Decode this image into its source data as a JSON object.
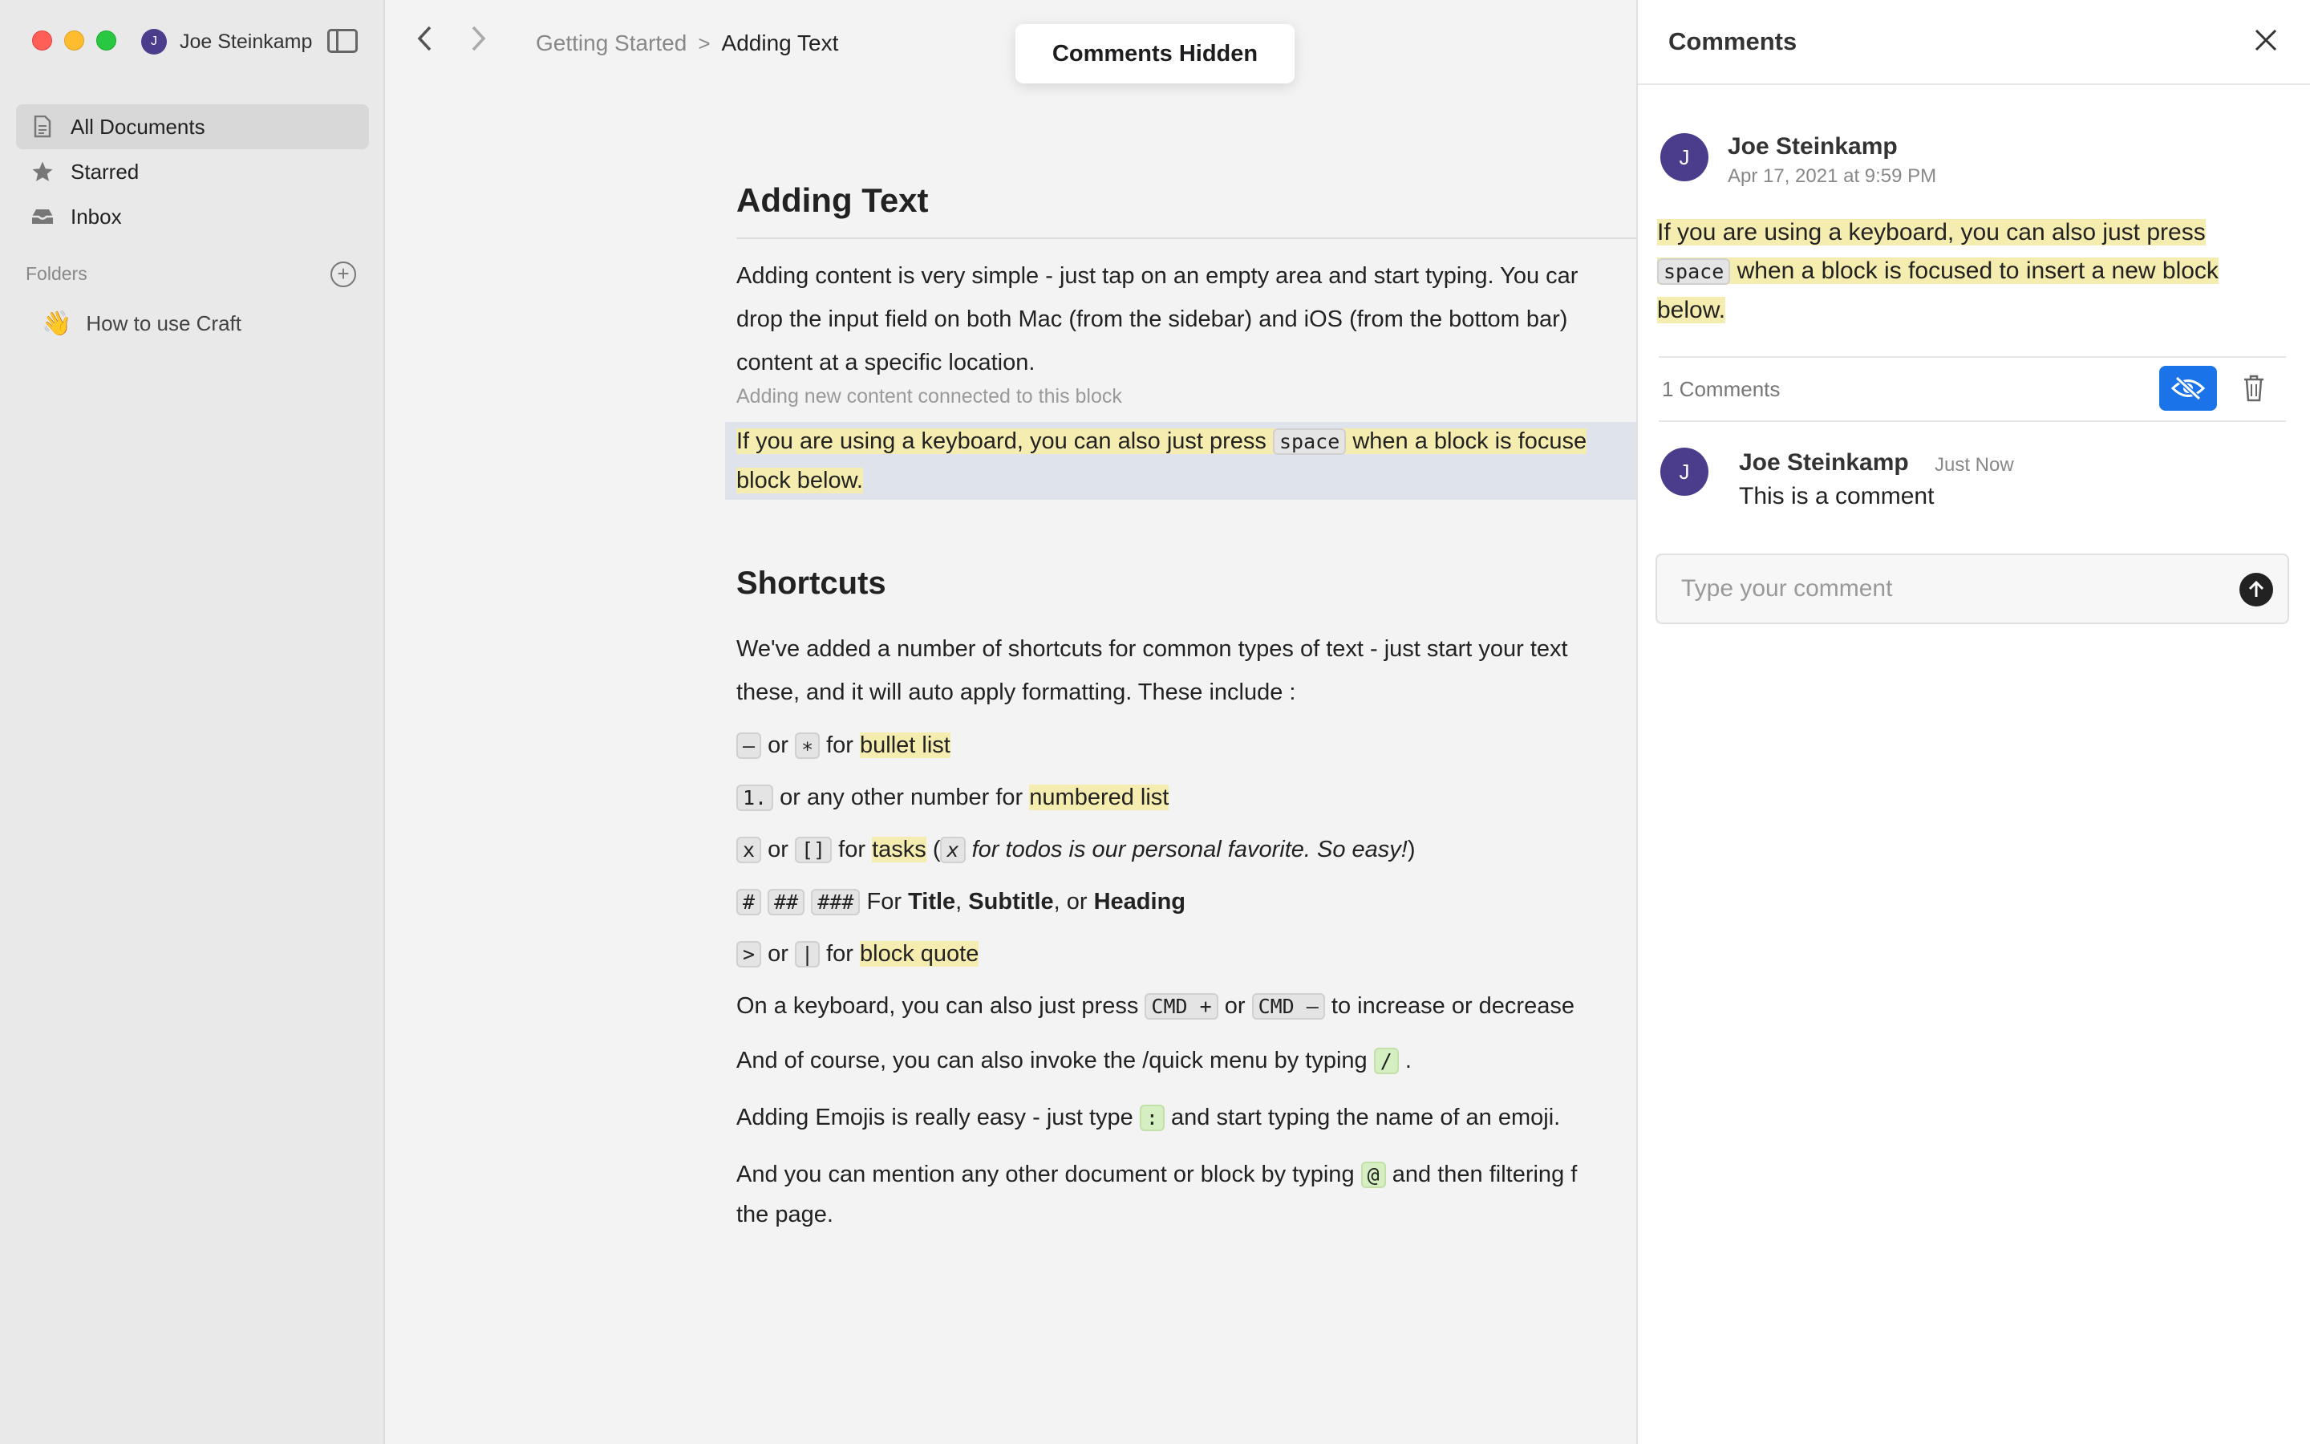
{
  "sidebar": {
    "user": {
      "initial": "J",
      "name": "Joe Steinkamp"
    },
    "nav": [
      {
        "label": "All Documents",
        "icon": "document-icon",
        "active": true
      },
      {
        "label": "Starred",
        "icon": "star-icon"
      },
      {
        "label": "Inbox",
        "icon": "inbox-icon"
      }
    ],
    "folders_label": "Folders",
    "folders": [
      {
        "emoji": "👋",
        "label": "How to use Craft"
      }
    ]
  },
  "toolbar": {
    "breadcrumb_parent": "Getting Started",
    "breadcrumb_separator": ">",
    "breadcrumb_current": "Adding Text",
    "toast": "Comments Hidden"
  },
  "document": {
    "title": "Adding Text",
    "intro_1": "Adding content is very simple - just tap on an empty area and start typing. You car",
    "intro_2": "drop the input field on both Mac (from the sidebar) and iOS (from the bottom bar)",
    "intro_3": "content at a specific location.",
    "meta_line": "Adding new content connected to this block",
    "selected_a": "If you are using a keyboard, you can also just press",
    "selected_code": "space",
    "selected_b": "when a block is focuse",
    "selected_c": "block below.",
    "shortcuts_title": "Shortcuts",
    "shortcuts_1": "We've added a number of shortcuts for common types of text - just start your text",
    "shortcuts_2": "these, and it will auto apply formatting. These include :",
    "l1": {
      "code_a": "–",
      "or": "or",
      "code_b": "∗",
      "for": "for",
      "hl": "bullet list"
    },
    "l2": {
      "code": "1.",
      "text": "or any other number for",
      "hl": "numbered list"
    },
    "l3": {
      "code_a": "x",
      "or": "or",
      "code_b": "[]",
      "for": "for",
      "hl": "tasks",
      "paren_open": "(",
      "code_c": "x",
      "italic": "for todos is our personal favorite. So easy!",
      "paren_close": ")"
    },
    "l4": {
      "code_a": "#",
      "code_b": "##",
      "code_c": "###",
      "text_a": "For",
      "b1": "Title",
      "comma1": ",",
      "b2": "Subtitle",
      "text_b": ", or",
      "b3": "Heading"
    },
    "l5": {
      "code_a": ">",
      "or": "or",
      "code_b": "|",
      "for": "for",
      "hl": "block quote"
    },
    "l6": {
      "text_a": "On a keyboard, you can also just press",
      "code_a": "CMD +",
      "or": "or",
      "code_b": "CMD –",
      "text_b": "to increase or decrease"
    },
    "l7": {
      "text": "And of course, you can also invoke the /quick menu by typing",
      "code": "/",
      "end": "."
    },
    "l8": {
      "text_a": "Adding Emojis is really easy - just type",
      "code": ":",
      "text_b": "and start typing the name of an emoji."
    },
    "l9": {
      "text_a": "And you can mention any other document or block by typing",
      "code": "@",
      "text_b": "and then filtering f",
      "text_c": "the page."
    }
  },
  "comments": {
    "title": "Comments",
    "thread": {
      "author_initial": "J",
      "author": "Joe  Steinkamp",
      "date": "Apr 17, 2021 at 9:59 PM",
      "quote_a": "If you are using a keyboard, you can also just press",
      "quote_code": "space",
      "quote_b": "when a block is focused to insert a new block",
      "quote_c": "below."
    },
    "count": "1 Comments",
    "reply": {
      "author_initial": "J",
      "author": "Joe  Steinkamp",
      "time": "Just Now",
      "text": "This is a comment"
    },
    "input_placeholder": "Type your comment"
  },
  "colors": {
    "accent": "#1a73e8",
    "highlight": "#f5edb0",
    "avatar": "#4b3c8c",
    "selection": "#dfe4ec"
  }
}
